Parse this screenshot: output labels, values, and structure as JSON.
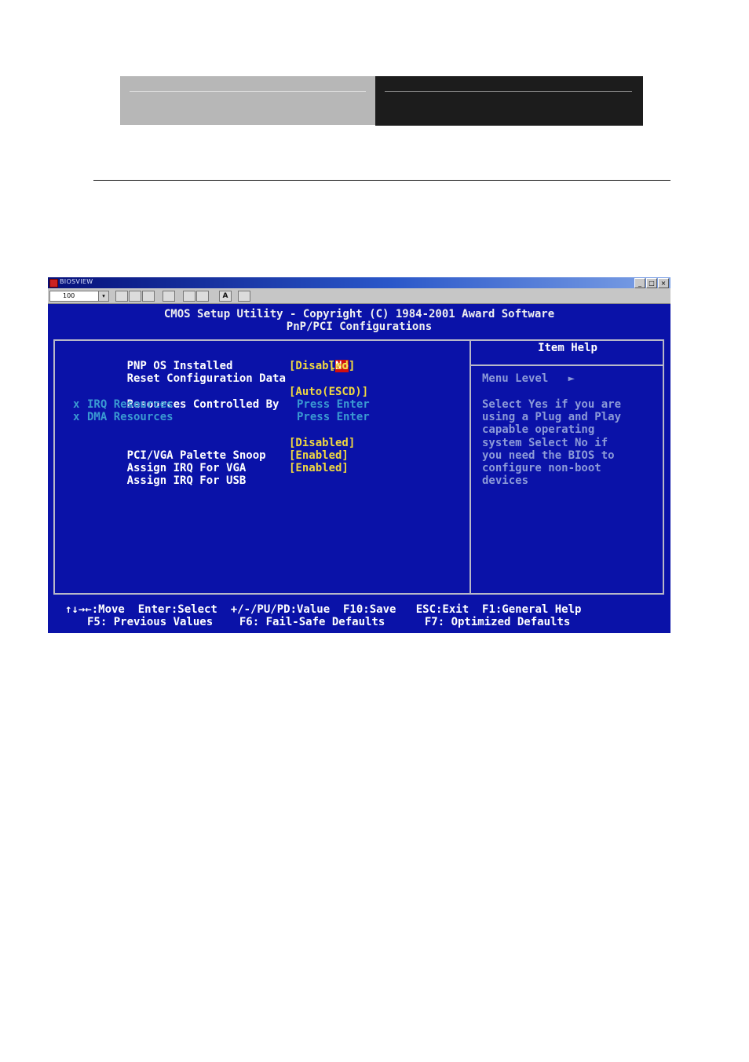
{
  "window": {
    "title": "BIOSVIEW",
    "toolbar": {
      "combo_value": "100",
      "combo_arrow": "▾",
      "font_button": "A"
    },
    "buttons": {
      "minimize": "_",
      "maximize": "□",
      "close": "×"
    }
  },
  "bios": {
    "header_line1": "CMOS Setup Utility - Copyright (C) 1984-2001 Award Software",
    "header_line2": "PnP/PCI Configurations",
    "items": [
      {
        "label": "PNP OS Installed",
        "value": "No",
        "selected": true
      },
      {
        "label": "Reset Configuration Data",
        "value": "[Disabled]"
      },
      {
        "label": "Resources Controlled By",
        "value": "[Auto(ESCD)]"
      },
      {
        "marker": "x",
        "label": "IRQ Resources",
        "value": "Press Enter",
        "disabled": true
      },
      {
        "marker": "x",
        "label": "DMA Resources",
        "value": "Press Enter",
        "disabled": true
      },
      {
        "label": "PCI/VGA Palette Snoop",
        "value": "[Disabled]"
      },
      {
        "label": "Assign IRQ For VGA",
        "value": "[Enabled]"
      },
      {
        "label": "Assign IRQ For USB",
        "value": "[Enabled]"
      }
    ],
    "help": {
      "title": "Item Help",
      "menu_level": "Menu Level   ►",
      "lines": [
        "Select Yes if you are",
        "using a Plug and Play",
        "capable operating",
        "system Select No if",
        "you need the BIOS to",
        "configure non-boot",
        "devices"
      ]
    },
    "footer_line1": "↑↓→←:Move  Enter:Select  +/-/PU/PD:Value  F10:Save   ESC:Exit  F1:General Help",
    "footer_line2": "F5: Previous Values    F6: Fail-Safe Defaults      F7: Optimized Defaults"
  }
}
